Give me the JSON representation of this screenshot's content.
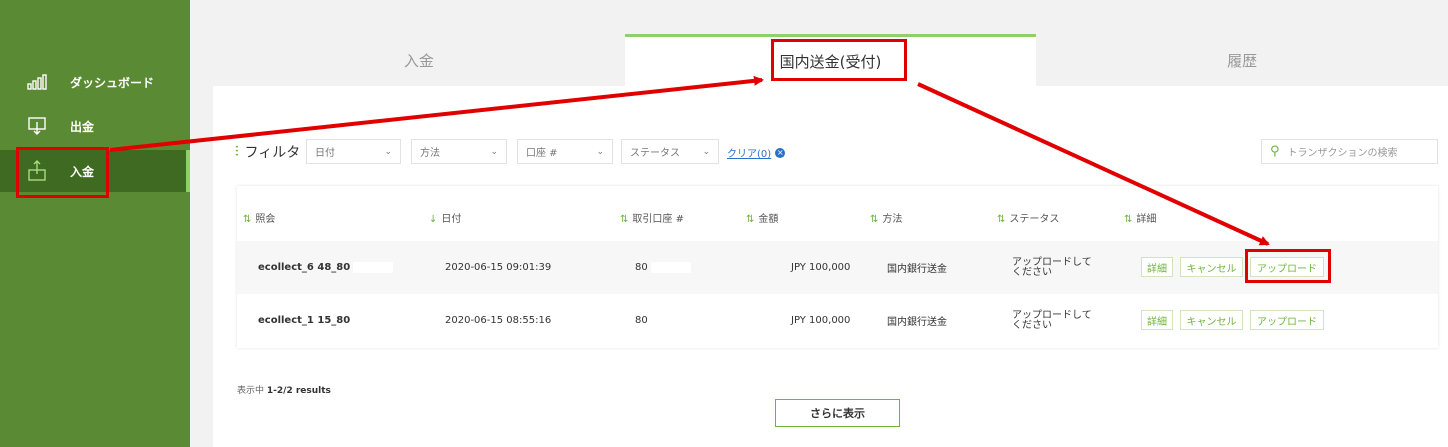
{
  "sidebar": {
    "items": [
      {
        "label": "ダッシュボード",
        "icon": "bar-chart-icon"
      },
      {
        "label": "出金",
        "icon": "withdraw-icon"
      },
      {
        "label": "入金",
        "icon": "deposit-icon"
      }
    ]
  },
  "tabs": [
    {
      "label": "入金"
    },
    {
      "label": "国内送金(受付)"
    },
    {
      "label": "履歴"
    }
  ],
  "filter": {
    "label": "フィルタ",
    "selects": [
      "日付",
      "方法",
      "口座 #",
      "ステータス"
    ],
    "clear": "クリア(0)",
    "search_placeholder": "トランザクションの検索"
  },
  "table": {
    "headers": [
      "照会",
      "日付",
      "取引口座 #",
      "金額",
      "方法",
      "ステータス",
      "詳細"
    ],
    "rows": [
      {
        "ref": "ecollect_6  48_80",
        "date": "2020-06-15 09:01:39",
        "account": "80",
        "amount": "JPY 100,000",
        "method": "国内銀行送金",
        "status_line1": "アップロードして",
        "status_line2": "ください"
      },
      {
        "ref": "ecollect_1  15_80",
        "date": "2020-06-15 08:55:16",
        "account": "80",
        "amount": "JPY 100,000",
        "method": "国内銀行送金",
        "status_line1": "アップロードして",
        "status_line2": "ください"
      }
    ],
    "actions": {
      "details": "詳細",
      "cancel": "キャンセル",
      "upload": "アップロード"
    }
  },
  "results": {
    "prefix": "表示中",
    "value": "1-2/2 results"
  },
  "show_more": "さらに表示",
  "colors": {
    "sidebar": "#5a8a34",
    "sidebar_active": "#3f6a22",
    "accent": "#6fb33e",
    "annotation": "#e00000"
  }
}
